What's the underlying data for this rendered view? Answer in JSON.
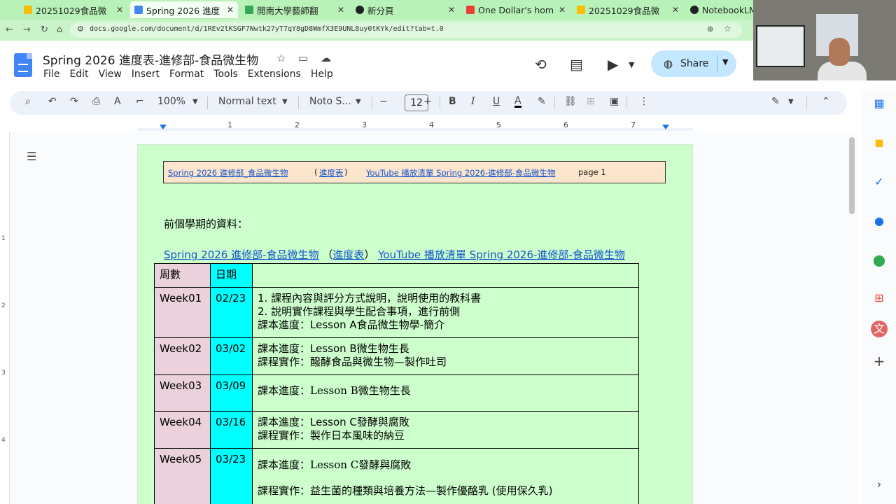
{
  "browser": {
    "tabs": [
      {
        "label": "20251029食品微",
        "color": "#fbbc04"
      },
      {
        "label": "Spring 2026 進度",
        "color": "#4285f4"
      },
      {
        "label": "開南大學藝師翻",
        "color": "#34a853"
      },
      {
        "label": "新分頁",
        "color": "#202124"
      },
      {
        "label": "One Dollar's hom",
        "color": "#ea4335"
      },
      {
        "label": "20251029食品微",
        "color": "#fbbc04"
      },
      {
        "label": "NotebookLM",
        "color": "#202124"
      }
    ],
    "url": "docs.google.com/document/d/1REv2tKSGF7Nwtk27yT7qY8gD8WmfX3E9UNL8uy0tKYk/edit?tab=t.0"
  },
  "doc": {
    "title": "Spring 2026 進度表-進修部-食品微生物",
    "menu": [
      "File",
      "Edit",
      "View",
      "Insert",
      "Format",
      "Tools",
      "Extensions",
      "Help"
    ],
    "share_label": "Share"
  },
  "toolbar": {
    "zoom": "100%",
    "style": "Normal text",
    "font": "Noto S...",
    "font_size": "12"
  },
  "ruler": [
    "1",
    "2",
    "3",
    "4",
    "5",
    "6",
    "7"
  ],
  "vruler": [
    "1",
    "2",
    "3",
    "4"
  ],
  "header_box": {
    "link1": "Spring 2026 進修部_食品微生物",
    "paren_open": "(",
    "link2": "進度表",
    "paren_close": ")",
    "link3": "YouTube 播放清單 Spring 2026-進修部-食品微生物",
    "page": "page 1"
  },
  "prev_label": "前個學期的資料：",
  "links_line": {
    "link1": "Spring 2026 進修部-食品微生物",
    "paren_open": "（",
    "link2": "進度表",
    "paren_close": "）",
    "link3": "YouTube 播放清單 Spring 2026-進修部-食品微生物"
  },
  "table": {
    "headers": [
      "周數",
      "日期",
      ""
    ],
    "rows": [
      {
        "week": "Week01",
        "date": "02/23",
        "lines": [
          "1. 課程內容與評分方式說明，說明使用的教科書",
          "2. 說明實作課程與學生配合事項，進行前側",
          "課本進度：Lesson A食品微生物學-簡介"
        ]
      },
      {
        "week": "Week02",
        "date": "03/02",
        "lines": [
          "課本進度：Lesson B微生物生長",
          "課程實作：醱酵食品與微生物—製作吐司"
        ]
      },
      {
        "week": "Week03",
        "date": "03/09",
        "prefix": "課本進度：",
        "serif_text": "Lesson B",
        "suffix": "微生物生長"
      },
      {
        "week": "Week04",
        "date": "03/16",
        "lines": [
          "課本進度：Lesson C發酵與腐敗",
          "課程實作：製作日本風味的納豆"
        ]
      },
      {
        "week": "Week05",
        "date": "03/23",
        "prefix": "課本進度：",
        "serif_text": "Lesson C",
        "suffix": "發酵與腐敗",
        "extra": "課程實作：益生菌的種類與培養方法—製作優酪乳 (使用保久乳)"
      }
    ]
  }
}
